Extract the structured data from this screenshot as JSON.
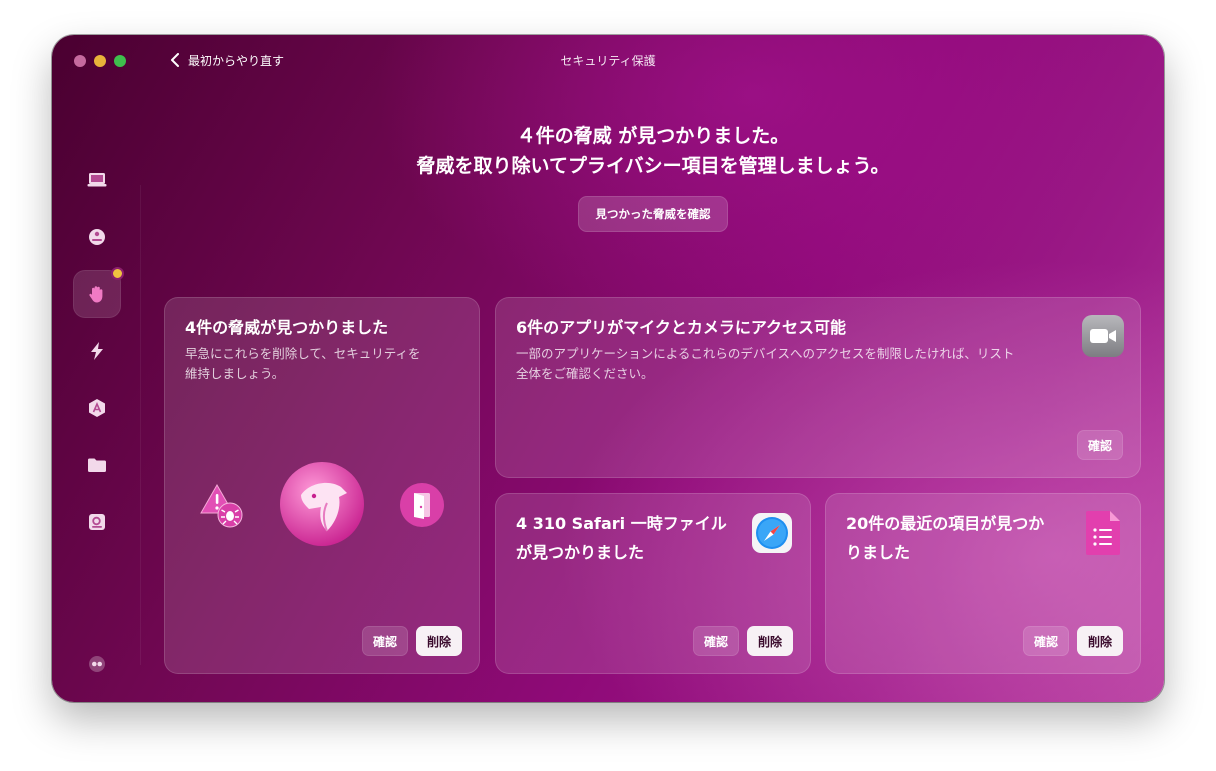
{
  "window": {
    "title": "セキュリティ保護",
    "back_label": "最初からやり直す"
  },
  "colors": {
    "accent_pink": "#e24fb5",
    "badge_yellow": "#f0c340",
    "delete_button_bg": "#f7f1f5"
  },
  "sidebar": {
    "items": [
      {
        "name": "smart-care-icon",
        "active": false
      },
      {
        "name": "cleanup-icon",
        "active": false
      },
      {
        "name": "protection-hand-icon",
        "active": true,
        "badge": true
      },
      {
        "name": "performance-icon",
        "active": false
      },
      {
        "name": "applications-icon",
        "active": false
      },
      {
        "name": "my-clutter-folder-icon",
        "active": false
      },
      {
        "name": "space-lens-icon",
        "active": false
      }
    ],
    "bottom_icon": "assistant-icon"
  },
  "headline": {
    "line1": "４件の脅威 が見つかりました。",
    "line2": "脅威を取り除いてプライバシー項目を管理しましょう。"
  },
  "review_threats_button": "見つかった脅威を確認",
  "cards": {
    "threats": {
      "title": "4件の脅威が見つかりました",
      "desc_line1": "早急にこれらを削除して、セキュリティを",
      "desc_line2": "維持しましょう。",
      "review_label": "確認",
      "delete_label": "削除"
    },
    "mic_camera": {
      "title": "6件のアプリがマイクとカメラにアクセス可能",
      "desc_line1": "一部のアプリケーションによるこれらのデバイスへのアクセスを制限したければ、リスト",
      "desc_line2": "全体をご確認ください。",
      "review_label": "確認",
      "icon": "video-camera-icon"
    },
    "safari": {
      "title_line1": "4 310 Safari 一時ファイル",
      "title_line2": "が見つかりました",
      "review_label": "確認",
      "delete_label": "削除",
      "icon": "safari-compass-icon"
    },
    "recent": {
      "title_line1": "20件の最近の項目が見つか",
      "title_line2": "りました",
      "review_label": "確認",
      "delete_label": "削除",
      "icon": "document-list-icon"
    }
  }
}
